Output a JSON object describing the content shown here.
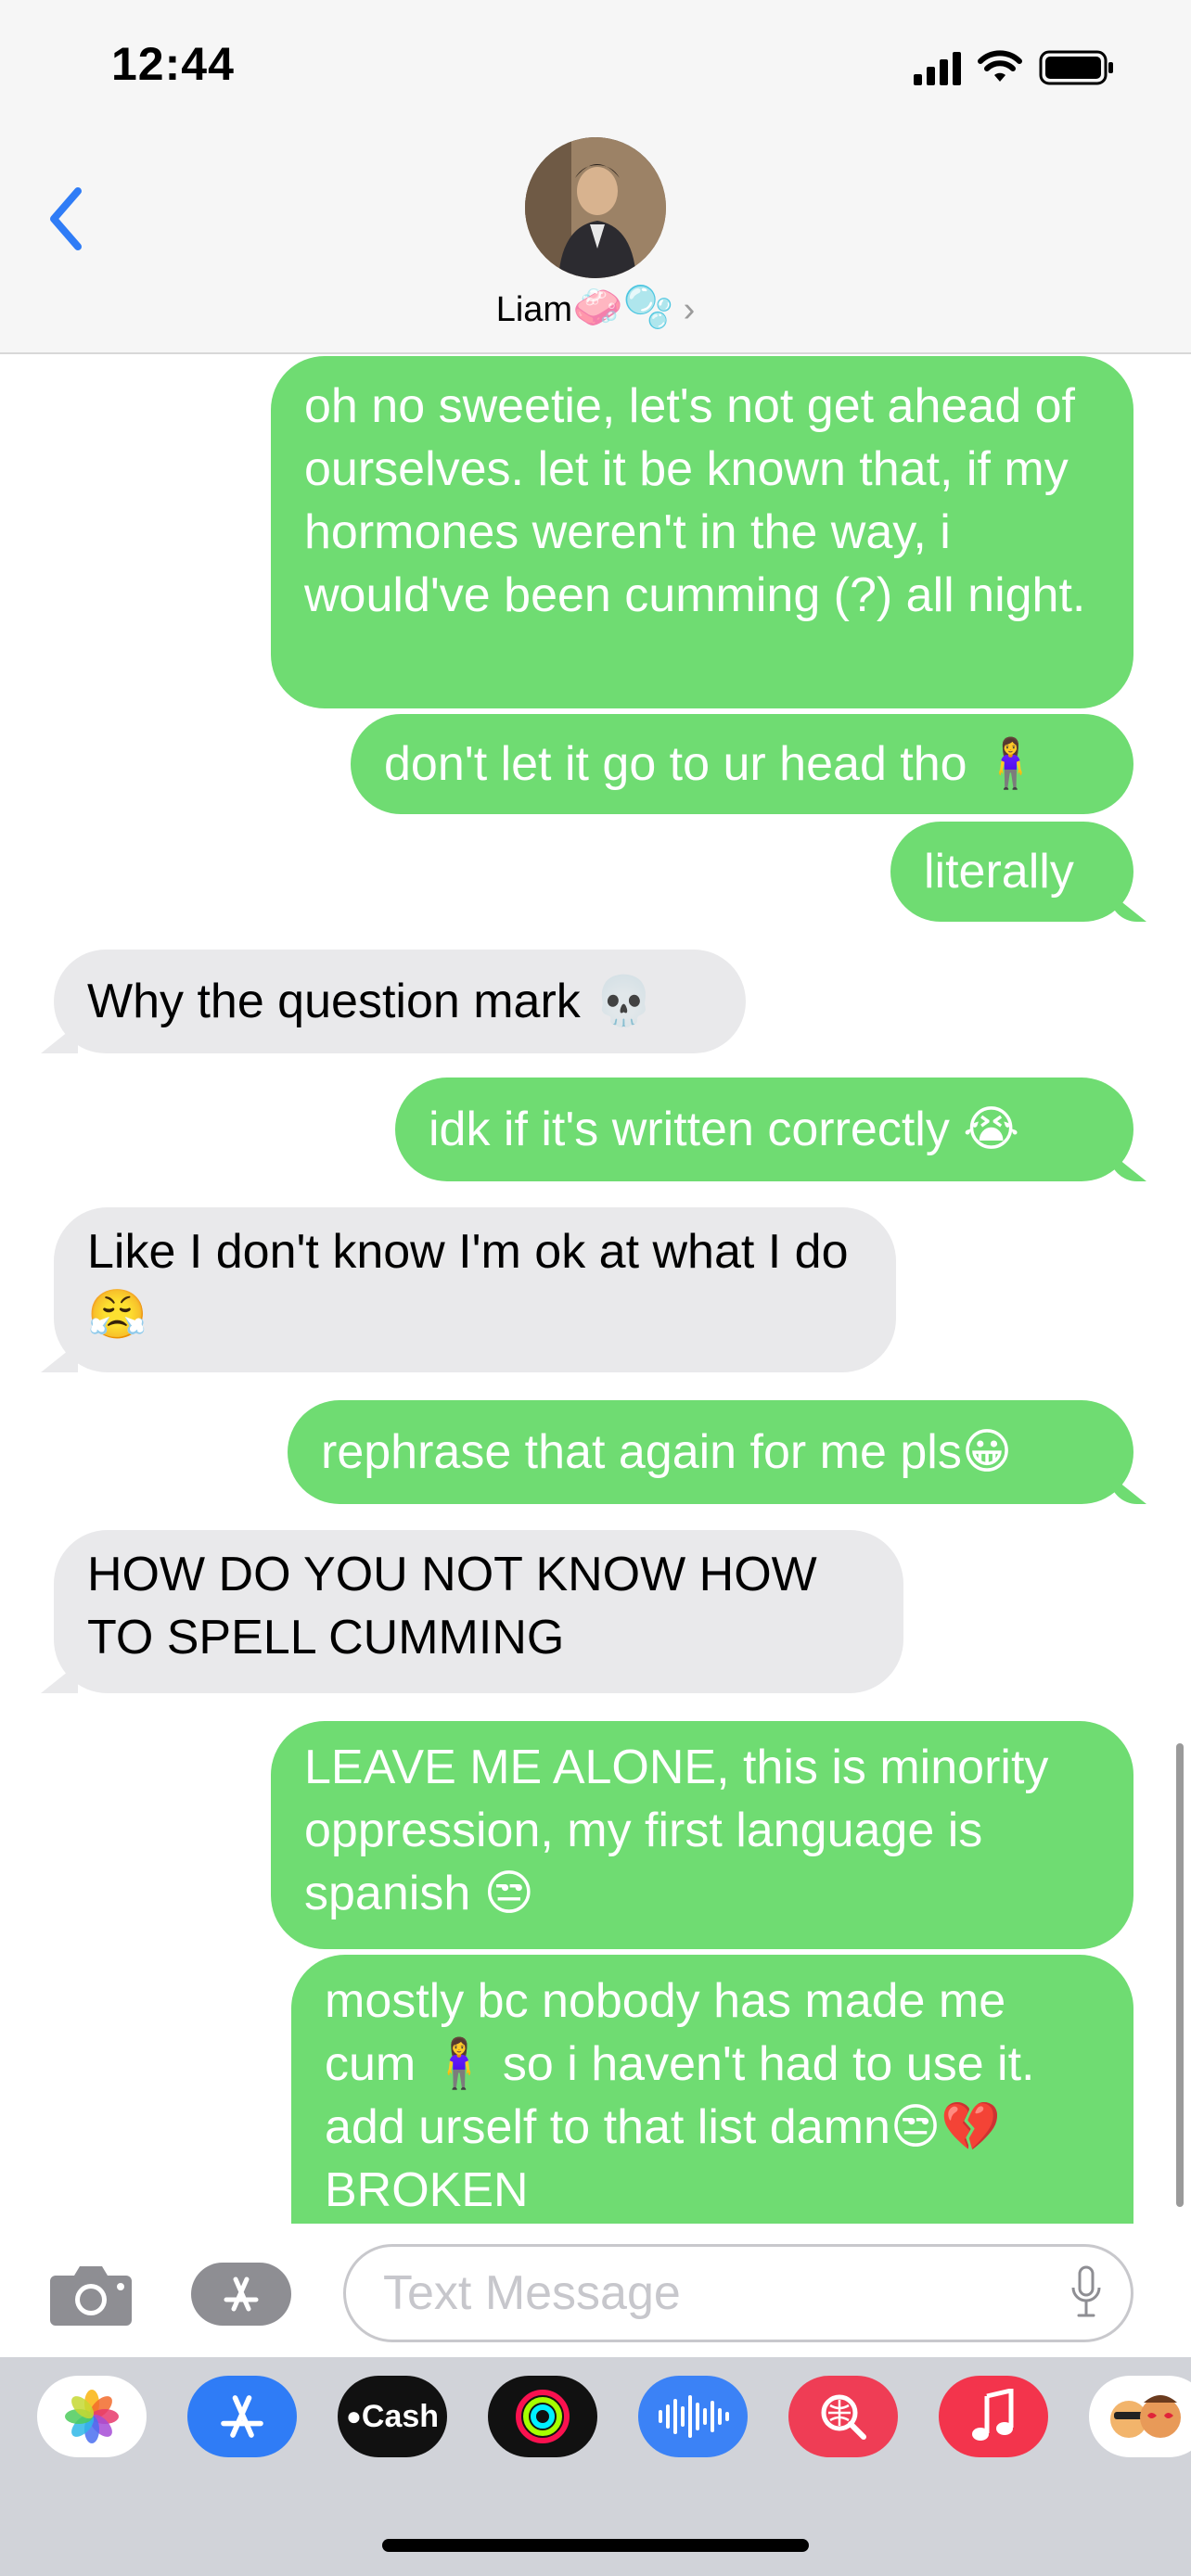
{
  "status_bar": {
    "time": "12:44"
  },
  "header": {
    "contact_name": "Liam",
    "contact_emojis": "🧼🫧",
    "chevron": "›"
  },
  "messages": [
    {
      "direction": "outgoing",
      "text": "oh no sweetie, let's not get ahead of ourselves. let it be known that, if my hormones weren't in the way, i would've been cumming (?) all night."
    },
    {
      "direction": "outgoing",
      "text": "don't let it go to ur head tho 🧍‍♀️"
    },
    {
      "direction": "outgoing",
      "text": "literally"
    },
    {
      "direction": "incoming",
      "text": "Why the question mark 💀"
    },
    {
      "direction": "outgoing",
      "text": "idk if it's written correctly 😭"
    },
    {
      "direction": "incoming",
      "text": "Like I don't know I'm ok at what I do 😤"
    },
    {
      "direction": "outgoing",
      "text": "rephrase that again for me pls😀"
    },
    {
      "direction": "incoming",
      "text": "HOW DO YOU NOT KNOW HOW TO SPELL CUMMING"
    },
    {
      "direction": "outgoing",
      "text": "LEAVE ME ALONE, this is minority oppression, my first language is spanish 😒"
    },
    {
      "direction": "outgoing",
      "text": "mostly bc nobody has made me cum 🧍‍♀️ so i haven't had to use it. add urself to that list damn😒💔 BROKEN"
    }
  ],
  "input": {
    "placeholder": "Text Message"
  },
  "app_drawer": [
    {
      "name": "Photos",
      "icon": "photos-icon"
    },
    {
      "name": "App Store",
      "icon": "app-store-icon"
    },
    {
      "name": "Cash",
      "icon": "apple-cash-icon",
      "label": "Cash"
    },
    {
      "name": "Activity",
      "icon": "activity-icon"
    },
    {
      "name": "Audio",
      "icon": "audio-message-icon"
    },
    {
      "name": "Images",
      "icon": "image-search-icon"
    },
    {
      "name": "Music",
      "icon": "music-icon"
    },
    {
      "name": "Memoji",
      "icon": "memoji-icon"
    }
  ],
  "colors": {
    "outgoing_bubble": "#6fdc72",
    "incoming_bubble": "#e9e9eb",
    "accent_blue": "#2f7cf6"
  }
}
